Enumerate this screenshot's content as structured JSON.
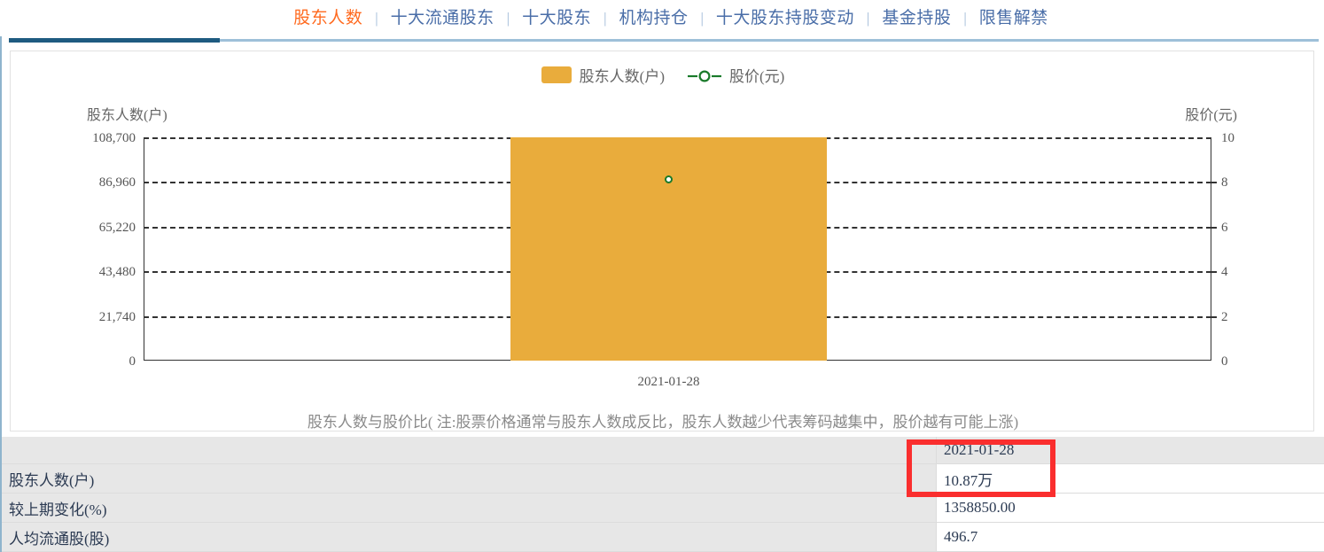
{
  "tabs": {
    "separator": "|",
    "items": [
      {
        "label": "股东人数",
        "active": true
      },
      {
        "label": "十大流通股东",
        "active": false
      },
      {
        "label": "十大股东",
        "active": false
      },
      {
        "label": "机构持仓",
        "active": false
      },
      {
        "label": "十大股东持股变动",
        "active": false
      },
      {
        "label": "基金持股",
        "active": false
      },
      {
        "label": "限售解禁",
        "active": false
      }
    ]
  },
  "legend": [
    {
      "label": "股东人数(户)",
      "marker": "square",
      "color": "#e9ac3c"
    },
    {
      "label": "股价(元)",
      "marker": "line-circle",
      "color": "#1a7a2a"
    }
  ],
  "chart_data": {
    "type": "bar",
    "title": "",
    "caption": "股东人数与股价比( 注:股票价格通常与股东人数成反比，股东人数越少代表筹码越集中，股价越有可能上涨)",
    "categories": [
      "2021-01-28"
    ],
    "xlabel": "",
    "grid": true,
    "legend_position": "top-center",
    "series": [
      {
        "name": "股东人数(户)",
        "type": "bar",
        "color": "#e9ac3c",
        "axis": "left",
        "values": [
          108700
        ]
      },
      {
        "name": "股价(元)",
        "type": "line",
        "color": "#1a7a2a",
        "axis": "right",
        "values": [
          8.3
        ]
      }
    ],
    "y_left": {
      "label": "股东人数(户)",
      "ticks": [
        "0",
        "21,740",
        "43,480",
        "65,220",
        "86,960",
        "108,700"
      ],
      "values": [
        0,
        21740,
        43480,
        65220,
        86960,
        108700
      ],
      "ylim": [
        0,
        108700
      ]
    },
    "y_right": {
      "label": "股价(元)",
      "ticks": [
        "0",
        "2",
        "4",
        "6",
        "8",
        "10"
      ],
      "values": [
        0,
        2,
        4,
        6,
        8,
        10
      ],
      "ylim": [
        0,
        10
      ]
    }
  },
  "table": {
    "header": [
      "",
      "2021-01-28",
      ""
    ],
    "rows": [
      {
        "label": "股东人数(户)",
        "value": "10.87万"
      },
      {
        "label": "较上期变化(%)",
        "value": "1358850.00"
      },
      {
        "label": "人均流通股(股)",
        "value": "496.7"
      }
    ]
  },
  "annotation": {
    "color": "#fa2e2e",
    "target": "股东人数 2021-01-28 单元格"
  },
  "colors": {
    "tab_active": "#ff6a1f",
    "tab_inactive": "#4a6ea8",
    "rule_dark": "#1e5b80",
    "rule_light": "#9ec0d9",
    "bar": "#e9ac3c",
    "price_marker": "#1a7a2a",
    "header_bg": "#e7e7e7"
  }
}
